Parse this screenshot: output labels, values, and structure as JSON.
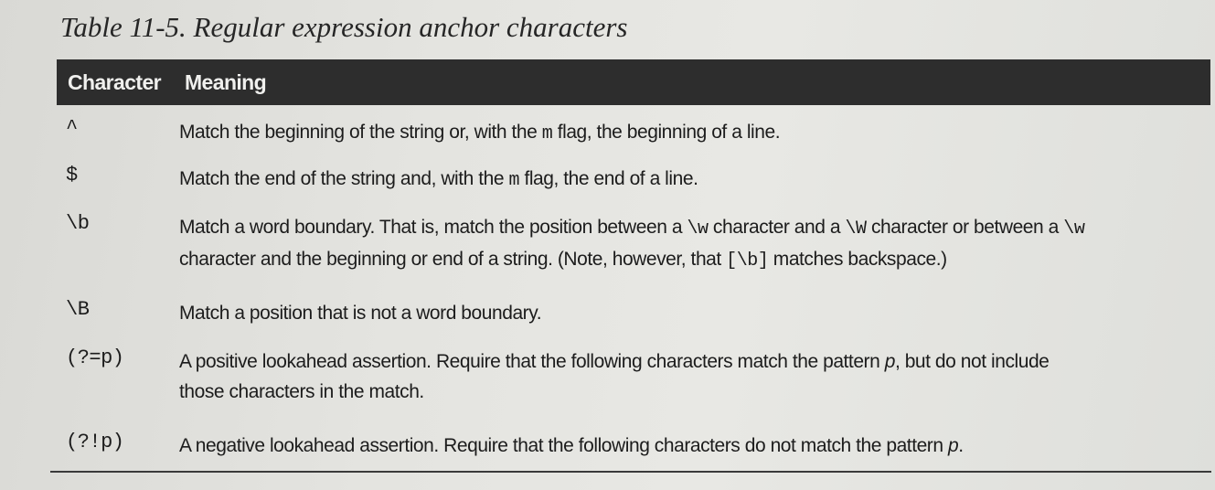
{
  "caption": "Table 11-5. Regular expression anchor characters",
  "header": {
    "character": "Character",
    "meaning": "Meaning"
  },
  "rows": [
    {
      "character": "^",
      "lines": [
        [
          {
            "t": "Match the beginning of the string or, with the "
          },
          {
            "t": "m",
            "mono": true
          },
          {
            "t": " flag, the beginning of a line."
          }
        ]
      ]
    },
    {
      "character": "$",
      "lines": [
        [
          {
            "t": "Match the end of the string and, with the "
          },
          {
            "t": "m",
            "mono": true
          },
          {
            "t": " flag, the end of a line."
          }
        ]
      ]
    },
    {
      "character": "\\b",
      "lines": [
        [
          {
            "t": "Match a word boundary. That is, match the position between a "
          },
          {
            "t": "\\w",
            "mono": true
          },
          {
            "t": " character and a "
          },
          {
            "t": "\\W",
            "mono": true
          },
          {
            "t": " character or between a "
          },
          {
            "t": "\\w",
            "mono": true
          }
        ],
        [
          {
            "t": "character and the beginning or end of a string. (Note, however, that "
          },
          {
            "t": "[\\b]",
            "mono": true
          },
          {
            "t": " matches backspace.)"
          }
        ]
      ]
    },
    {
      "character": "\\B",
      "lines": [
        [
          {
            "t": "Match a position that is not a word boundary."
          }
        ]
      ]
    },
    {
      "character": "(?=p)",
      "lines": [
        [
          {
            "t": "A positive lookahead assertion. Require that the following characters match the pattern "
          },
          {
            "t": "p",
            "it": true
          },
          {
            "t": ", but do not include"
          }
        ],
        [
          {
            "t": "those characters in the match."
          }
        ]
      ]
    },
    {
      "character": "(?!p)",
      "lines": [
        [
          {
            "t": "A negative lookahead assertion. Require that the following characters do not match the pattern "
          },
          {
            "t": "p",
            "it": true
          },
          {
            "t": "."
          }
        ]
      ]
    }
  ]
}
